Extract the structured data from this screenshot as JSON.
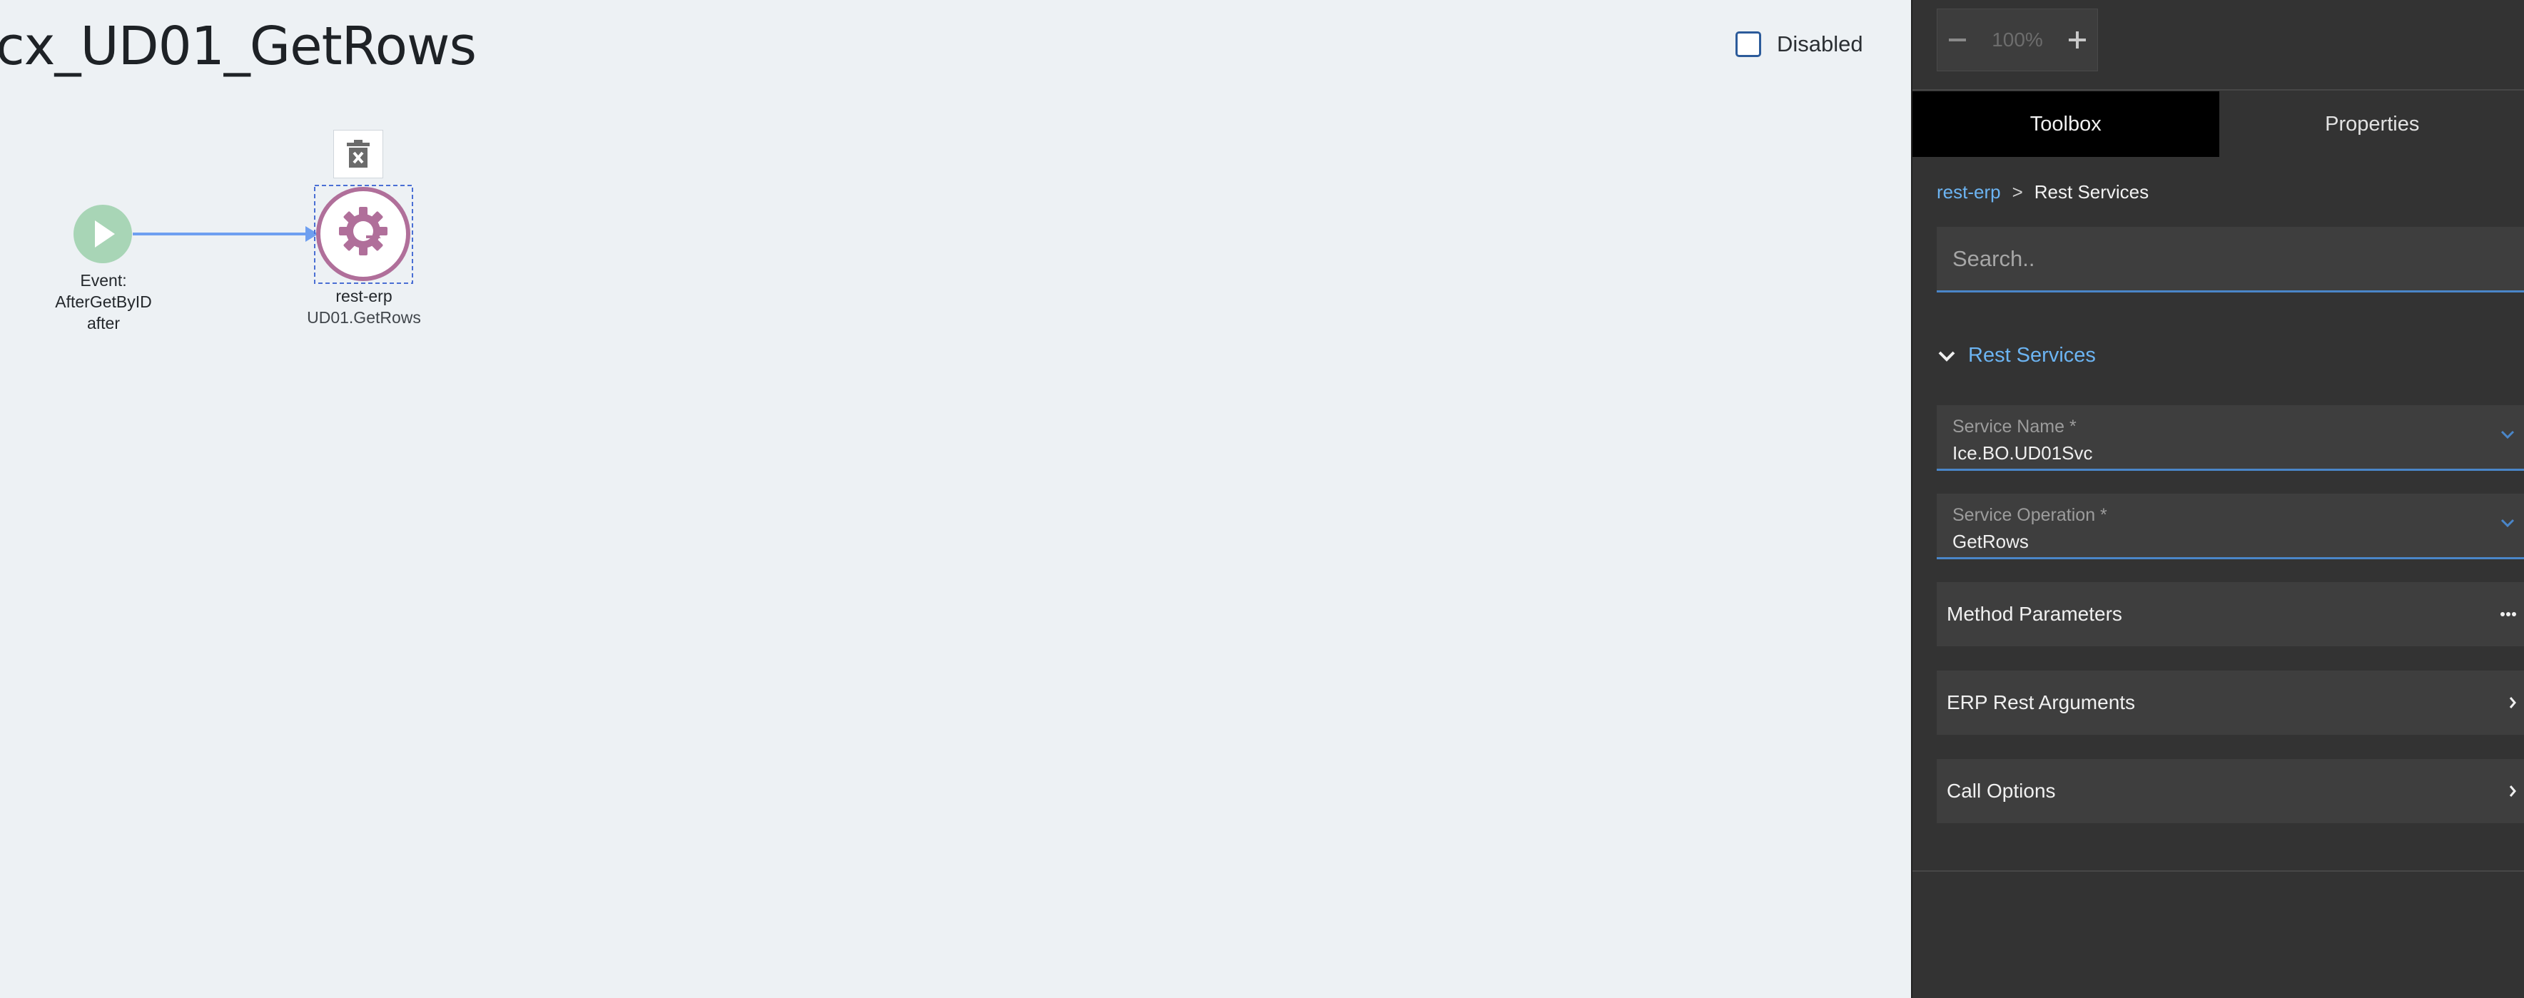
{
  "canvas": {
    "title": "cx_UD01_GetRows",
    "disabled_label": "Disabled",
    "disabled_checked": false,
    "nodes": {
      "start": {
        "line1": "Event:",
        "line2": "AfterGetByID",
        "line3": "after",
        "color": "#a8d5b6"
      },
      "service": {
        "name": "rest-erp",
        "subtitle": "UD01.GetRows",
        "color": "#b06f9a"
      }
    }
  },
  "panel": {
    "zoom": {
      "minus": "−",
      "level": "100%",
      "plus": "+"
    },
    "tabs": [
      {
        "label": "Toolbox",
        "active": true
      },
      {
        "label": "Properties",
        "active": false
      }
    ],
    "breadcrumb": {
      "link": "rest-erp",
      "separator": ">",
      "current": "Rest Services"
    },
    "search": {
      "placeholder": "Search.."
    },
    "section": {
      "title": "Rest Services",
      "expanded": true
    },
    "service_name": {
      "label": "Service Name *",
      "value": "Ice.BO.UD01Svc"
    },
    "service_operation": {
      "label": "Service Operation *",
      "value": "GetRows"
    },
    "expanders": [
      {
        "title": "Method Parameters",
        "icon": "ellipsis-icon"
      },
      {
        "title": "ERP Rest Arguments",
        "icon": "chevron-right-icon"
      },
      {
        "title": "Call Options",
        "icon": "chevron-right-icon"
      }
    ],
    "colors": {
      "accent": "#6cb4f2",
      "panel_bg": "#333333",
      "canvas_bg": "#edf1f4",
      "underline": "#4a86c9"
    }
  }
}
